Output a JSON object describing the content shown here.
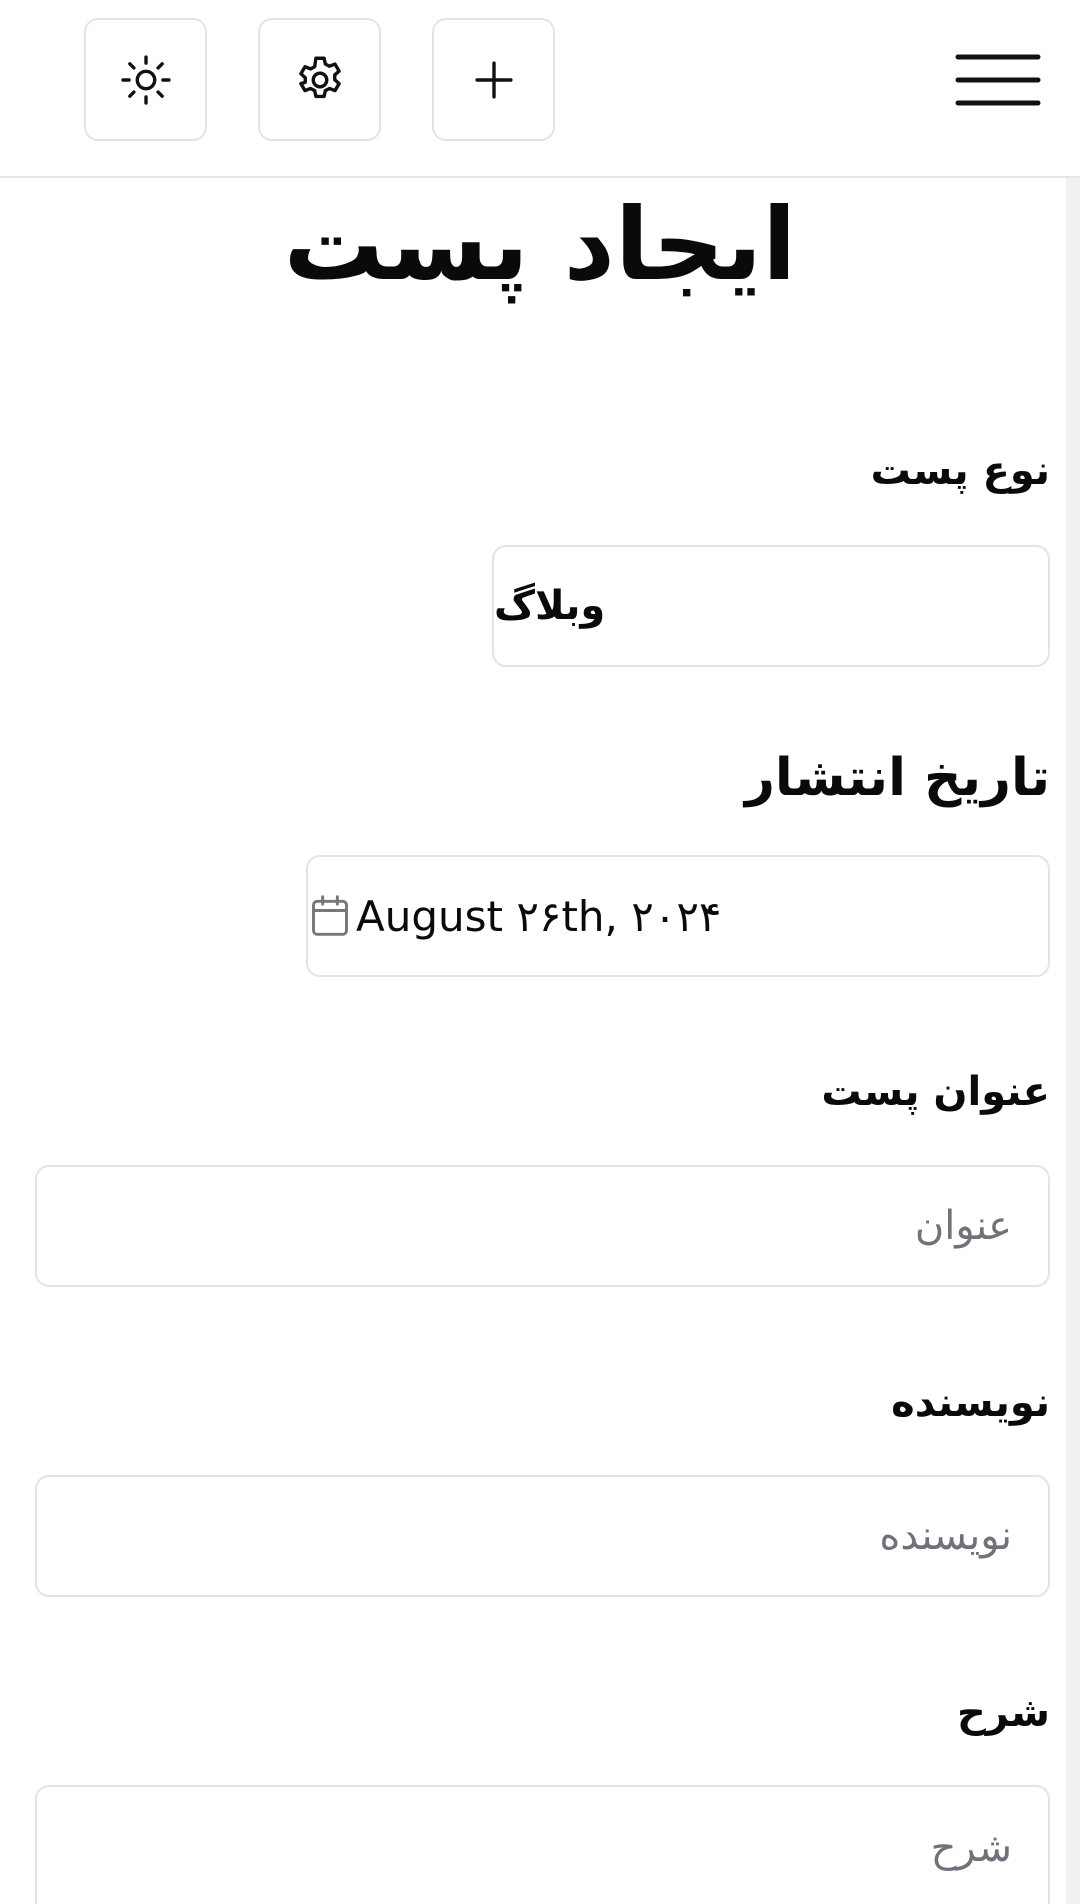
{
  "header": {
    "theme_icon": "sun-icon",
    "settings_icon": "gear-icon",
    "add_icon": "plus-icon",
    "menu_icon": "hamburger-menu-icon"
  },
  "page": {
    "title": "ایجاد پست"
  },
  "form": {
    "post_type": {
      "label": "نوع پست",
      "value": "وبلاگ"
    },
    "publish_date": {
      "label": "تاریخ انتشار",
      "value": "August ۲۶th, ۲۰۲۴",
      "icon": "calendar-icon"
    },
    "post_title": {
      "label": "عنوان پست",
      "placeholder": "عنوان"
    },
    "author": {
      "label": "نویسنده",
      "placeholder": "نویسنده"
    },
    "description": {
      "label": "شرح",
      "placeholder": "شرح"
    }
  },
  "colors": {
    "border": "#e4e4e7",
    "placeholder": "#71717a",
    "text": "#0a0a0a"
  }
}
